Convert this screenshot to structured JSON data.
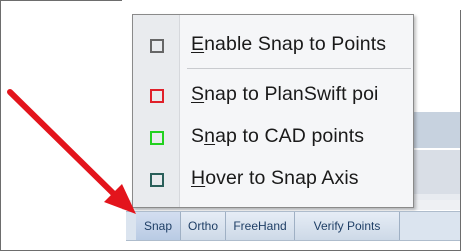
{
  "menu": {
    "items": [
      {
        "prefix": "",
        "mnemonic": "E",
        "rest": "nable Snap to Points",
        "box_color": "#666666"
      },
      {
        "prefix": "",
        "mnemonic": "S",
        "rest": "nap to PlanSwift poi",
        "box_color": "#e0202a"
      },
      {
        "prefix": "S",
        "mnemonic": "n",
        "rest": "ap to CAD points",
        "box_color": "#22d11f"
      },
      {
        "prefix": "",
        "mnemonic": "H",
        "rest": "over to Snap Axis",
        "box_color": "#2a5f5a"
      }
    ]
  },
  "toolbar": {
    "buttons": [
      "Snap",
      "Ortho",
      "FreeHand",
      "Verify Points"
    ]
  },
  "colors": {
    "arrow": "#e3141c",
    "toolbar_text": "#1f3f66"
  }
}
